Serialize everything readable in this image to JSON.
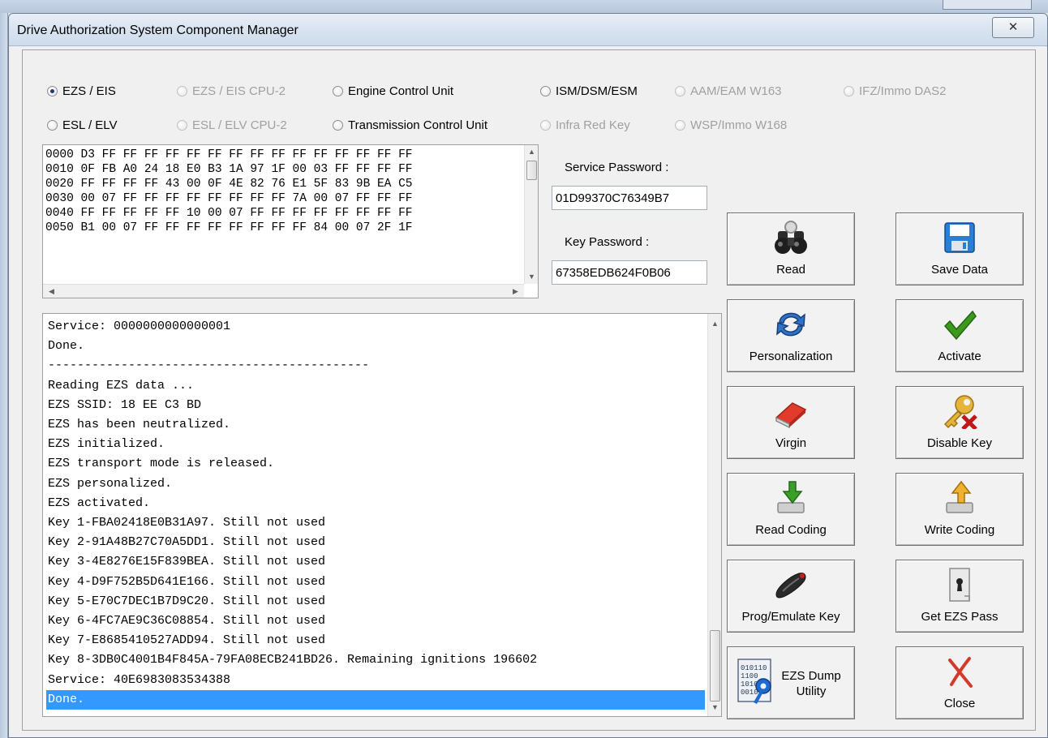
{
  "dialog": {
    "title": "Drive Authorization System Component Manager",
    "close_glyph": "✕"
  },
  "radios": [
    {
      "label": "EZS / EIS",
      "checked": true,
      "enabled": true
    },
    {
      "label": "EZS / EIS CPU-2",
      "checked": false,
      "enabled": false
    },
    {
      "label": "Engine Control Unit",
      "checked": false,
      "enabled": true
    },
    {
      "label": "ISM/DSM/ESM",
      "checked": false,
      "enabled": true
    },
    {
      "label": "AAM/EAM W163",
      "checked": false,
      "enabled": false
    },
    {
      "label": "IFZ/Immo DAS2",
      "checked": false,
      "enabled": false
    },
    {
      "label": "ESL / ELV",
      "checked": false,
      "enabled": true
    },
    {
      "label": "ESL / ELV CPU-2",
      "checked": false,
      "enabled": false
    },
    {
      "label": "Transmission Control Unit",
      "checked": false,
      "enabled": true
    },
    {
      "label": "Infra Red Key",
      "checked": false,
      "enabled": false
    },
    {
      "label": "WSP/Immo W168",
      "checked": false,
      "enabled": false
    }
  ],
  "hex_dump": [
    "0000 D3 FF FF FF FF FF FF FF FF FF FF FF FF FF FF FF",
    "0010 0F FB A0 24 18 E0 B3 1A 97 1F 00 03 FF FF FF FF",
    "0020 FF FF FF FF 43 00 0F 4E 82 76 E1 5F 83 9B EA C5",
    "0030 00 07 FF FF FF FF FF FF FF FF 7A 00 07 FF FF FF",
    "0040 FF FF FF FF FF 10 00 07 FF FF FF FF FF FF FF FF",
    "0050 B1 00 07 FF FF FF FF FF FF FF FF 84 00 07 2F 1F"
  ],
  "passwords": {
    "service_label": "Service Password :",
    "service_value": "01D99370C76349B7",
    "key_label": "Key Password :",
    "key_value": "67358EDB624F0B06"
  },
  "log": [
    "Service: 0000000000000001",
    "Done.",
    "--------------------------------------------",
    "Reading EZS data ...",
    "EZS SSID: 18 EE C3 BD",
    "EZS has been neutralized.",
    "EZS initialized.",
    "EZS transport mode is released.",
    "EZS personalized.",
    "EZS activated.",
    "Key 1-FBA02418E0B31A97. Still not used",
    "Key 2-91A48B27C70A5DD1. Still not used",
    "Key 3-4E8276E15F839BEA. Still not used",
    "Key 4-D9F752B5D641E166. Still not used",
    "Key 5-E70C7DEC1B7D9C20. Still not used",
    "Key 6-4FC7AE9C36C08854. Still not used",
    "Key 7-E8685410527ADD94. Still not used",
    "Key 8-3DB0C4001B4F845A-79FA08ECB241BD26. Remaining ignitions 196602",
    "Service: 40E6983083534388",
    "Done."
  ],
  "buttons": {
    "read": "Read",
    "save_data": "Save Data",
    "personalization": "Personalization",
    "activate": "Activate",
    "virgin": "Virgin",
    "disable_key": "Disable Key",
    "read_coding": "Read Coding",
    "write_coding": "Write Coding",
    "prog_emulate_key": "Prog/Emulate Key",
    "get_ezs_pass": "Get EZS Pass",
    "ezs_dump_line1": "EZS Dump",
    "ezs_dump_line2": "Utility",
    "close": "Close",
    "ezs_dump_icon_digits": "010110\n1100\n1010\n0010"
  },
  "colors": {
    "selection": "#3399ff",
    "check_green": "#3b9a1e",
    "close_red": "#d23a2a"
  }
}
